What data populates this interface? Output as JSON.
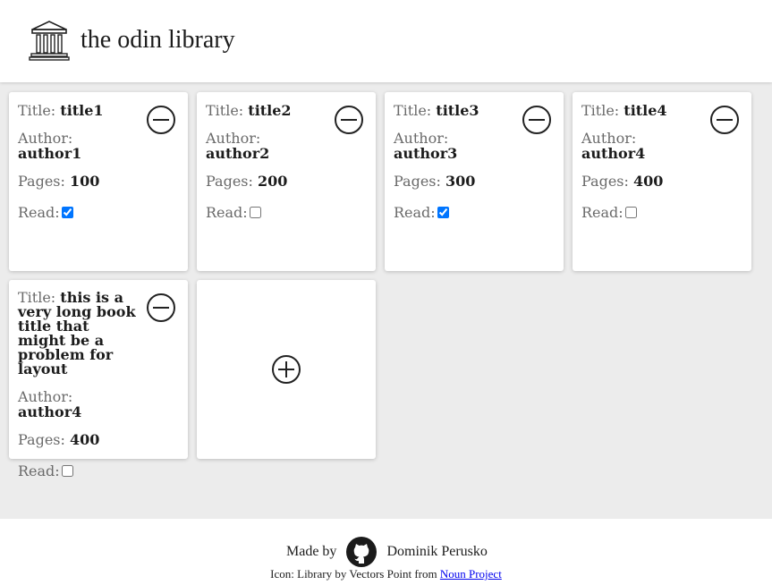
{
  "header": {
    "title": "the odin library",
    "logo_icon": "library-building-icon"
  },
  "labels": {
    "title": "Title:",
    "author": "Author:",
    "pages": "Pages:",
    "read": "Read:"
  },
  "books": [
    {
      "title": "title1",
      "author": "author1",
      "pages": "100",
      "read": true
    },
    {
      "title": "title2",
      "author": "author2",
      "pages": "200",
      "read": false
    },
    {
      "title": "title3",
      "author": "author3",
      "pages": "300",
      "read": true
    },
    {
      "title": "title4",
      "author": "author4",
      "pages": "400",
      "read": false
    },
    {
      "title": "this is a very long book title that might be a problem for layout",
      "author": "author4",
      "pages": "400",
      "read": false
    }
  ],
  "icons": {
    "remove": "minus-circle-icon",
    "add": "plus-circle-icon",
    "github": "github-icon"
  },
  "footer": {
    "made_by": "Made by",
    "author_name": "Dominik Perusko",
    "credit_text": "Icon: Library by Vectors Point from",
    "credit_link": "Noun Project"
  }
}
